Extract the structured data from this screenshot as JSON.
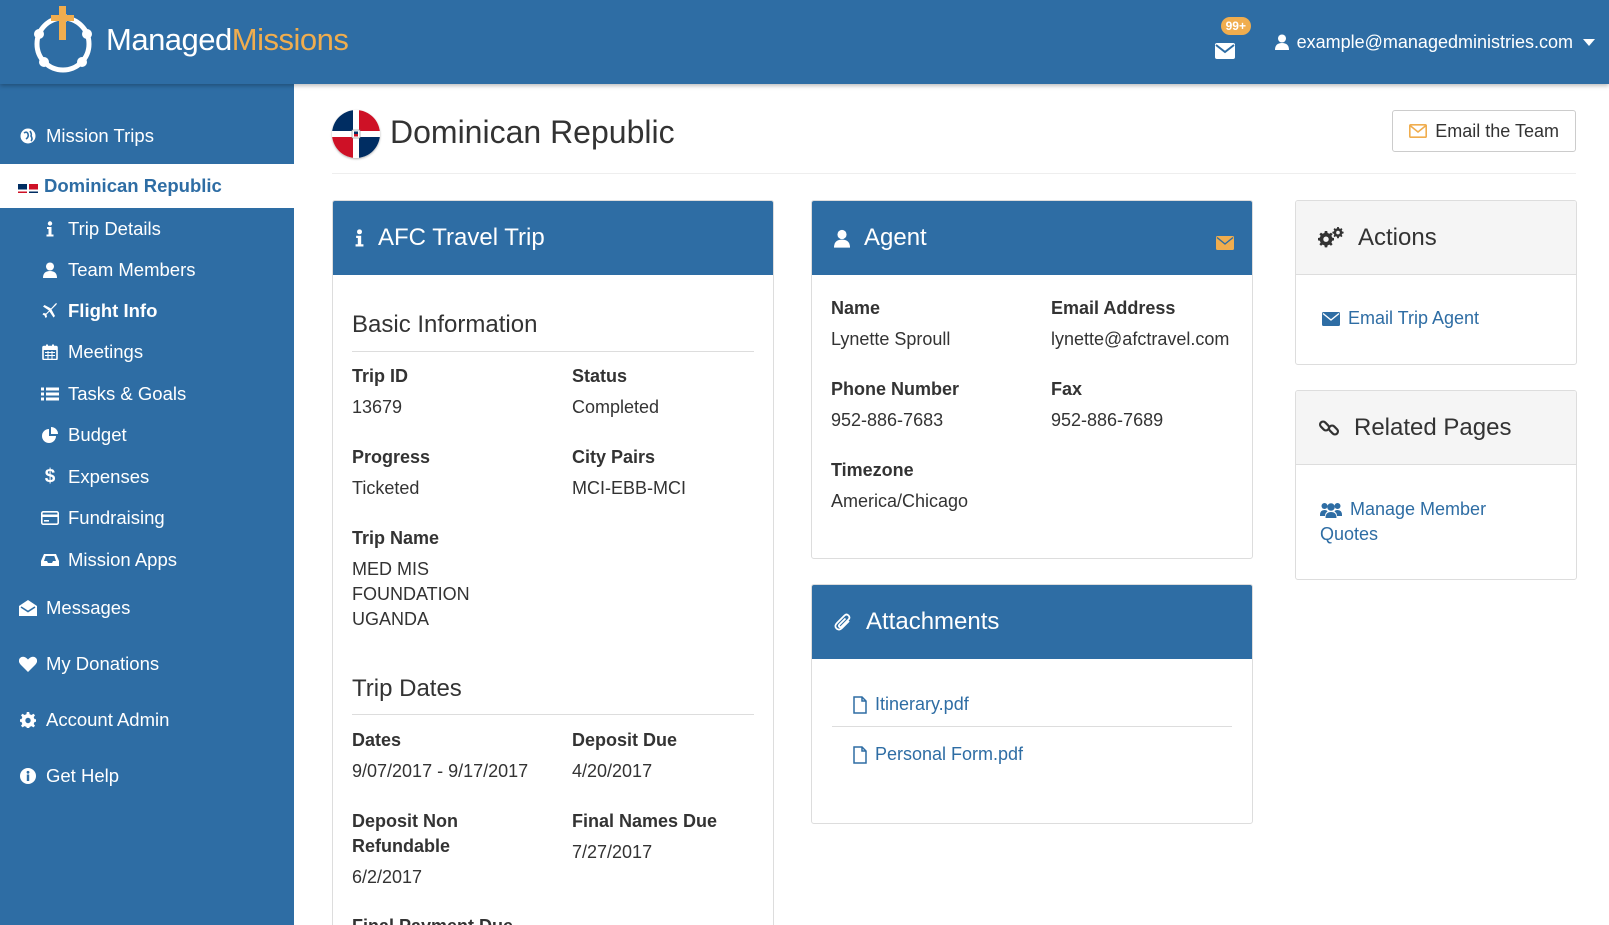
{
  "brand": {
    "name_part1": "Managed",
    "name_part2": "Missions"
  },
  "header": {
    "notification_count": "99+",
    "user_email": "example@managedministries.com"
  },
  "sidebar": {
    "items": [
      {
        "label": "Mission Trips",
        "icon": "globe-icon"
      },
      {
        "label": "Dominican Republic",
        "icon": "flag-icon",
        "active": true
      },
      {
        "label": "Trip Details",
        "icon": "info-icon"
      },
      {
        "label": "Team Members",
        "icon": "user-icon"
      },
      {
        "label": "Flight Info",
        "icon": "plane-icon"
      },
      {
        "label": "Meetings",
        "icon": "calendar-icon"
      },
      {
        "label": "Tasks & Goals",
        "icon": "list-icon"
      },
      {
        "label": "Budget",
        "icon": "pie-chart-icon"
      },
      {
        "label": "Expenses",
        "icon": "dollar-icon"
      },
      {
        "label": "Fundraising",
        "icon": "credit-card-icon"
      },
      {
        "label": "Mission Apps",
        "icon": "inbox-icon"
      },
      {
        "label": "Messages",
        "icon": "envelope-open-icon"
      },
      {
        "label": "My Donations",
        "icon": "heart-icon"
      },
      {
        "label": "Account Admin",
        "icon": "gear-icon"
      },
      {
        "label": "Get Help",
        "icon": "info-circle-icon"
      }
    ]
  },
  "page": {
    "title": "Dominican Republic",
    "email_team_label": "Email the Team"
  },
  "trip_panel": {
    "title": "AFC Travel Trip",
    "basic_info_title": "Basic Information",
    "trip_id_label": "Trip ID",
    "trip_id": "13679",
    "status_label": "Status",
    "status": "Completed",
    "progress_label": "Progress",
    "progress": "Ticketed",
    "city_pairs_label": "City Pairs",
    "city_pairs": "MCI-EBB-MCI",
    "trip_name_label": "Trip Name",
    "trip_name_1": "MED MIS",
    "trip_name_2": "FOUNDATION",
    "trip_name_3": "UGANDA",
    "trip_dates_title": "Trip Dates",
    "dates_label": "Dates",
    "dates": "9/07/2017 - 9/17/2017",
    "deposit_due_label": "Deposit Due",
    "deposit_due": "4/20/2017",
    "deposit_nonref_label_1": "Deposit Non",
    "deposit_nonref_label_2": "Refundable",
    "deposit_nonref": "6/2/2017",
    "final_names_label": "Final Names Due",
    "final_names": "7/27/2017",
    "final_payment_label": "Final Payment Due"
  },
  "agent_panel": {
    "title": "Agent",
    "name_label": "Name",
    "name": "Lynette Sproull",
    "email_label": "Email Address",
    "email": "lynette@afctravel.com",
    "phone_label": "Phone Number",
    "phone": "952-886-7683",
    "fax_label": "Fax",
    "fax": "952-886-7689",
    "timezone_label": "Timezone",
    "timezone": "America/Chicago"
  },
  "attachments_panel": {
    "title": "Attachments",
    "files": [
      "Itinerary.pdf",
      "Personal Form.pdf"
    ]
  },
  "actions_panel": {
    "title": "Actions",
    "email_agent_label": "Email Trip Agent"
  },
  "related_panel": {
    "title": "Related Pages",
    "link_line1": "Manage Member",
    "link_line2": "Quotes"
  },
  "colors": {
    "primary": "#2e6da4",
    "accent": "#f0ad4e"
  }
}
